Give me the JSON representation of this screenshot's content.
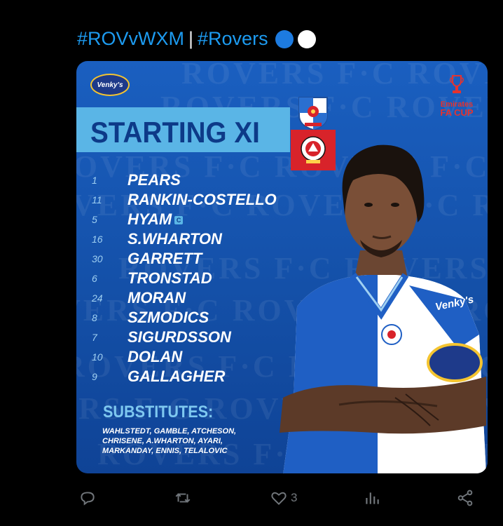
{
  "tweet": {
    "hashtag1": "#ROVvWXM",
    "separator": "|",
    "hashtag2": "#Rovers",
    "emoji_colors": [
      "#1d7be0",
      "#ffffff"
    ]
  },
  "graphic": {
    "sponsor_logo": "Venky's",
    "competition_line1": "Emirates",
    "competition_line2": "FA CUP",
    "title": "STARTING XI",
    "home_crest_icon": "blackburn-rovers-crest-icon",
    "away_crest_icon": "wrexham-crest-icon",
    "watermark": "ROVERS F·C ROVERS F·C ROVERS",
    "players": [
      {
        "number": "1",
        "name": "PEARS"
      },
      {
        "number": "11",
        "name": "RANKIN-COSTELLO"
      },
      {
        "number": "5",
        "name": "HYAM",
        "captain_badge": "C"
      },
      {
        "number": "16",
        "name": "S.WHARTON"
      },
      {
        "number": "30",
        "name": "GARRETT"
      },
      {
        "number": "6",
        "name": "TRONSTAD"
      },
      {
        "number": "24",
        "name": "MORAN"
      },
      {
        "number": "8",
        "name": "SZMODICS"
      },
      {
        "number": "7",
        "name": "SIGURDSSON"
      },
      {
        "number": "10",
        "name": "DOLAN"
      },
      {
        "number": "9",
        "name": "GALLAGHER"
      }
    ],
    "substitutes_title": "SUBSTITUTES:",
    "substitutes_lines": [
      "WAHLSTEDT, GAMBLE, ATCHESON,",
      "CHRISENE, A.WHARTON, AYARI,",
      "MARKANDAY, ENNIS, TELALOVIC"
    ],
    "shirt_sponsor": "Venky's",
    "colors": {
      "background": "#1450a8",
      "title_bar": "#5ab5e6",
      "title_text": "#0d3a88",
      "accent_red": "#e4332f"
    }
  },
  "actions": {
    "reply_icon": "reply-icon",
    "retweet_icon": "retweet-icon",
    "like_icon": "heart-icon",
    "like_count": "3",
    "views_icon": "views-icon",
    "share_icon": "share-icon"
  }
}
